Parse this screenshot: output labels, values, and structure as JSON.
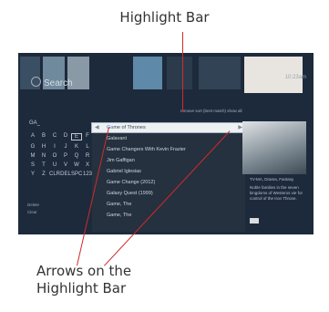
{
  "callouts": {
    "title": "Highlight Bar",
    "arrows_line1": "Arrows on the",
    "arrows_line2": "Highlight Bar"
  },
  "screen": {
    "search_title": "Search",
    "time": "10:23am",
    "hint": "remove  sort (best match)  show all",
    "query": "GA_",
    "keyboard": [
      "A",
      "B",
      "C",
      "D",
      "E",
      "F",
      "G",
      "H",
      "I",
      "J",
      "K",
      "L",
      "M",
      "N",
      "O",
      "P",
      "Q",
      "R",
      "S",
      "T",
      "U",
      "V",
      "W",
      "X",
      "Y",
      "Z",
      "CLR",
      "DEL",
      "SPC",
      "123"
    ],
    "selected_key": "E",
    "keyboard_extra": [
      "Delete",
      "Clear"
    ],
    "highlight_bar": {
      "match": "Ga",
      "rest": "me of Thrones"
    },
    "results": [
      "Galavant",
      "Game Changers With Kevin Frazier",
      "Jim Gaffigan",
      "Gabriel Iglesias",
      "Game Change (2012)",
      "Galaxy Quest (1999)",
      "Game, The",
      "Game, The"
    ],
    "side_panel": {
      "meta": "TV-MA, Drama, Fantasy",
      "description": "Noble families in the seven kingdoms of Westeros vie for control of the Iron Throne."
    },
    "colors": {
      "highlight": "#eef0f2",
      "background": "#1d2a3c",
      "callout_line": "#d12a2a"
    }
  }
}
